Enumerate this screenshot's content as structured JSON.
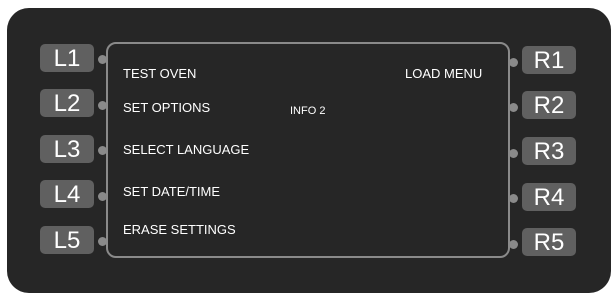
{
  "screen": {
    "title": "INFO 2",
    "left_items": [
      "TEST OVEN",
      "SET OPTIONS",
      "SELECT LANGUAGE",
      "SET DATE/TIME",
      "ERASE SETTINGS"
    ],
    "right_items": [
      "LOAD MENU"
    ]
  },
  "softkeys": {
    "left": [
      "L1",
      "L2",
      "L3",
      "L4",
      "L5"
    ],
    "right": [
      "R1",
      "R2",
      "R3",
      "R4",
      "R5"
    ]
  },
  "colors": {
    "panel": "#262626",
    "key": "#606060",
    "screen_border": "#8a8a8a",
    "text": "#ffffff"
  }
}
